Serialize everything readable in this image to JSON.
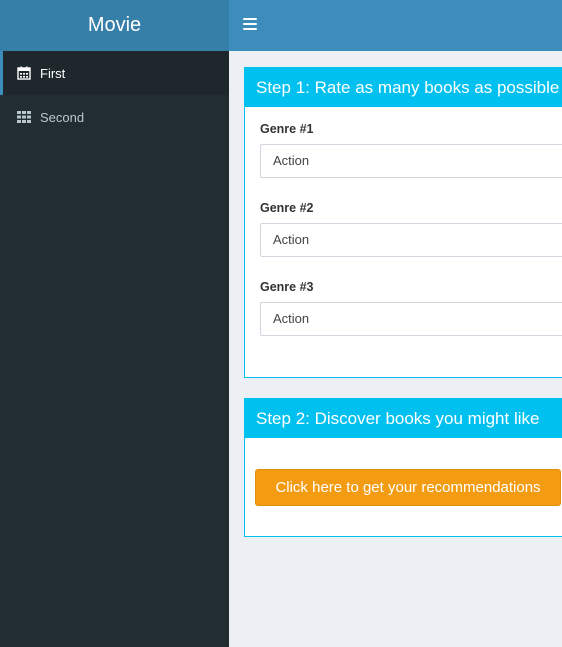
{
  "app": {
    "title": "Movie"
  },
  "sidebar": {
    "items": [
      {
        "label": "First",
        "icon": "calendar-icon",
        "active": true
      },
      {
        "label": "Second",
        "icon": "grid-icon",
        "active": false
      }
    ]
  },
  "header": {
    "toggle_icon": "hamburger-icon"
  },
  "step1": {
    "title": "Step 1: Rate as many books as possible",
    "genres": [
      {
        "label": "Genre #1",
        "value": "Action"
      },
      {
        "label": "Genre #2",
        "value": "Action"
      },
      {
        "label": "Genre #3",
        "value": "Action"
      }
    ]
  },
  "step2": {
    "title": "Step 2: Discover books you might like",
    "button_label": "Click here to get your recommendations"
  },
  "colors": {
    "logo_bg": "#367fa9",
    "navbar_bg": "#3c8dbc",
    "sidebar_bg": "#222d32",
    "box_header_bg": "#00c0ef",
    "button_bg": "#f39c12",
    "content_bg": "#ecf0f5"
  }
}
